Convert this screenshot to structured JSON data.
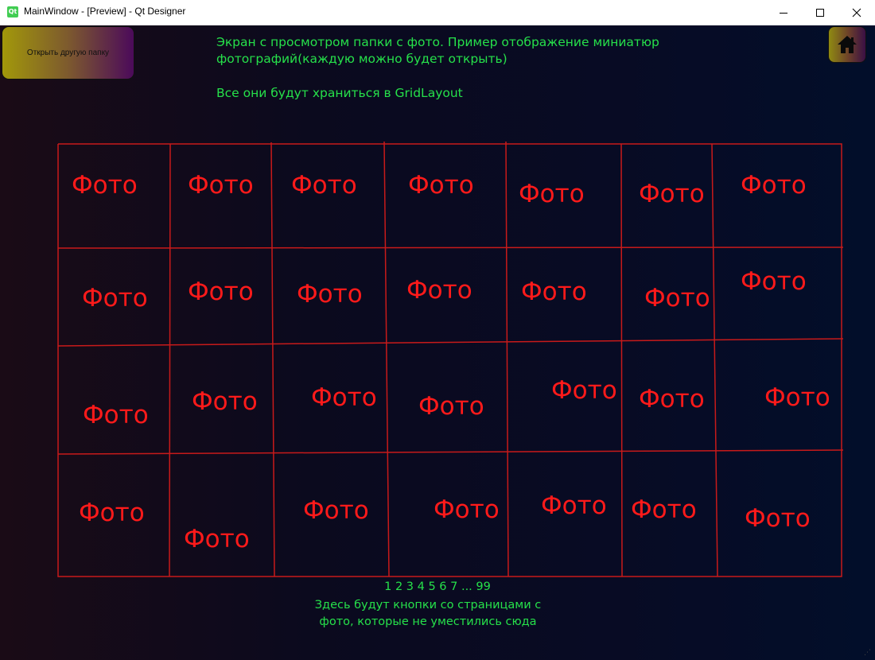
{
  "window": {
    "title": "MainWindow - [Preview] - Qt Designer",
    "icon": "qt-icon",
    "icon_text": "Qt",
    "controls": [
      "minimize-icon",
      "maximize-icon",
      "close-icon"
    ]
  },
  "toolbar": {
    "open_other_folder_label": "Открыть другую папку",
    "home_icon": "home-icon"
  },
  "description": {
    "line1": "Экран с просмотром папки с фото. Пример отображение миниатюр фотографий(каждую можно будет открыть)",
    "line2": "Все они будут храниться в GridLayout"
  },
  "grid": {
    "rows": 4,
    "columns": 7,
    "cells": [
      [
        "Фото",
        "Фото",
        "Фото",
        "Фото",
        "Фото",
        "Фото",
        "Фото"
      ],
      [
        "Фото",
        "Фото",
        "Фото",
        "Фото",
        "Фото",
        "Фото",
        "Фото"
      ],
      [
        "Фото",
        "Фото",
        "Фото",
        "Фото",
        "Фото",
        "Фото",
        "Фото"
      ],
      [
        "Фото",
        "Фото",
        "Фото",
        "Фото",
        "Фото",
        "Фото",
        "Фото"
      ]
    ],
    "line_color": "#c81a1a",
    "text_color": "#ff1a1a"
  },
  "pagination": {
    "label": "1 2 3 4 5 6 7 ... 99"
  },
  "footer_note": {
    "line1": "Здесь будут кнопки со страницами с",
    "line2": "фото, которые не уместились сюда"
  },
  "colors": {
    "accent_text": "#26e04a",
    "foto_text": "#ff1a1a"
  }
}
